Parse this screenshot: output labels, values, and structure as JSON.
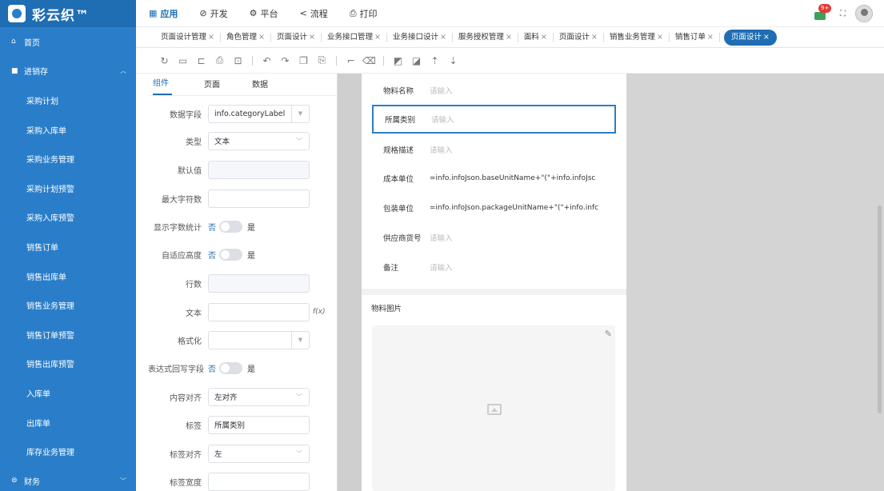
{
  "app": {
    "name": "彩云织™"
  },
  "top_menu": [
    {
      "icon": "▦",
      "label": "应用",
      "active": true
    },
    {
      "icon": "⊘",
      "label": "开发"
    },
    {
      "icon": "⚙",
      "label": "平台"
    },
    {
      "icon": "<",
      "label": "流程"
    },
    {
      "icon": "⎙",
      "label": "打印"
    }
  ],
  "header": {
    "badge": "9+"
  },
  "sidebar": {
    "home": "首页",
    "group": "进销存",
    "items": [
      "采购计划",
      "采购入库单",
      "采购业务管理",
      "采购计划预警",
      "采购入库预警",
      "销售订单",
      "销售出库单",
      "销售业务管理",
      "销售订单预警",
      "销售出库预警",
      "入库单",
      "出库单",
      "库存业务管理"
    ],
    "finance": "财务"
  },
  "tabs": [
    "页面设计管理",
    "角色管理",
    "页面设计",
    "业务接口管理",
    "业务接口设计",
    "服务授权管理",
    "面料",
    "页面设计",
    "销售业务管理",
    "销售订单"
  ],
  "active_tab": "页面设计",
  "tab_close": "×",
  "panel": {
    "tabs": [
      "组件",
      "页面",
      "数据"
    ],
    "fields": {
      "data_field": {
        "label": "数据字段",
        "value": "info.categoryLabel"
      },
      "type": {
        "label": "类型",
        "value": "文本"
      },
      "default": {
        "label": "默认值"
      },
      "max_chars": {
        "label": "最大字符数"
      },
      "show_count": {
        "label": "显示字数统计",
        "off": "否",
        "on": "是"
      },
      "auto_height": {
        "label": "自适应高度",
        "off": "否",
        "on": "是"
      },
      "rows": {
        "label": "行数"
      },
      "text": {
        "label": "文本",
        "fx": "f(x)"
      },
      "format": {
        "label": "格式化"
      },
      "writeback": {
        "label": "表达式回写字段",
        "off": "否",
        "on": "是"
      },
      "align": {
        "label": "内容对齐",
        "value": "左对齐"
      },
      "tag": {
        "label": "标签",
        "value": "所属类别"
      },
      "tag_align": {
        "label": "标签对齐",
        "value": "左"
      },
      "tag_width": {
        "label": "标签宽度"
      }
    }
  },
  "form": {
    "rows": [
      {
        "label": "物料名称",
        "value": "请输入"
      },
      {
        "label": "所属类别",
        "value": "请输入"
      },
      {
        "label": "规格描述",
        "value": "请输入"
      },
      {
        "label": "成本单位",
        "value": "=info.infoJson.baseUnitName+\"(\"+info.infoJsc"
      },
      {
        "label": "包装单位",
        "value": "=info.infoJson.packageUnitName+\"(\"+info.infc"
      },
      {
        "label": "供应商货号",
        "value": "请输入"
      },
      {
        "label": "备注",
        "value": "请输入"
      }
    ],
    "image_section": "物料图片"
  }
}
